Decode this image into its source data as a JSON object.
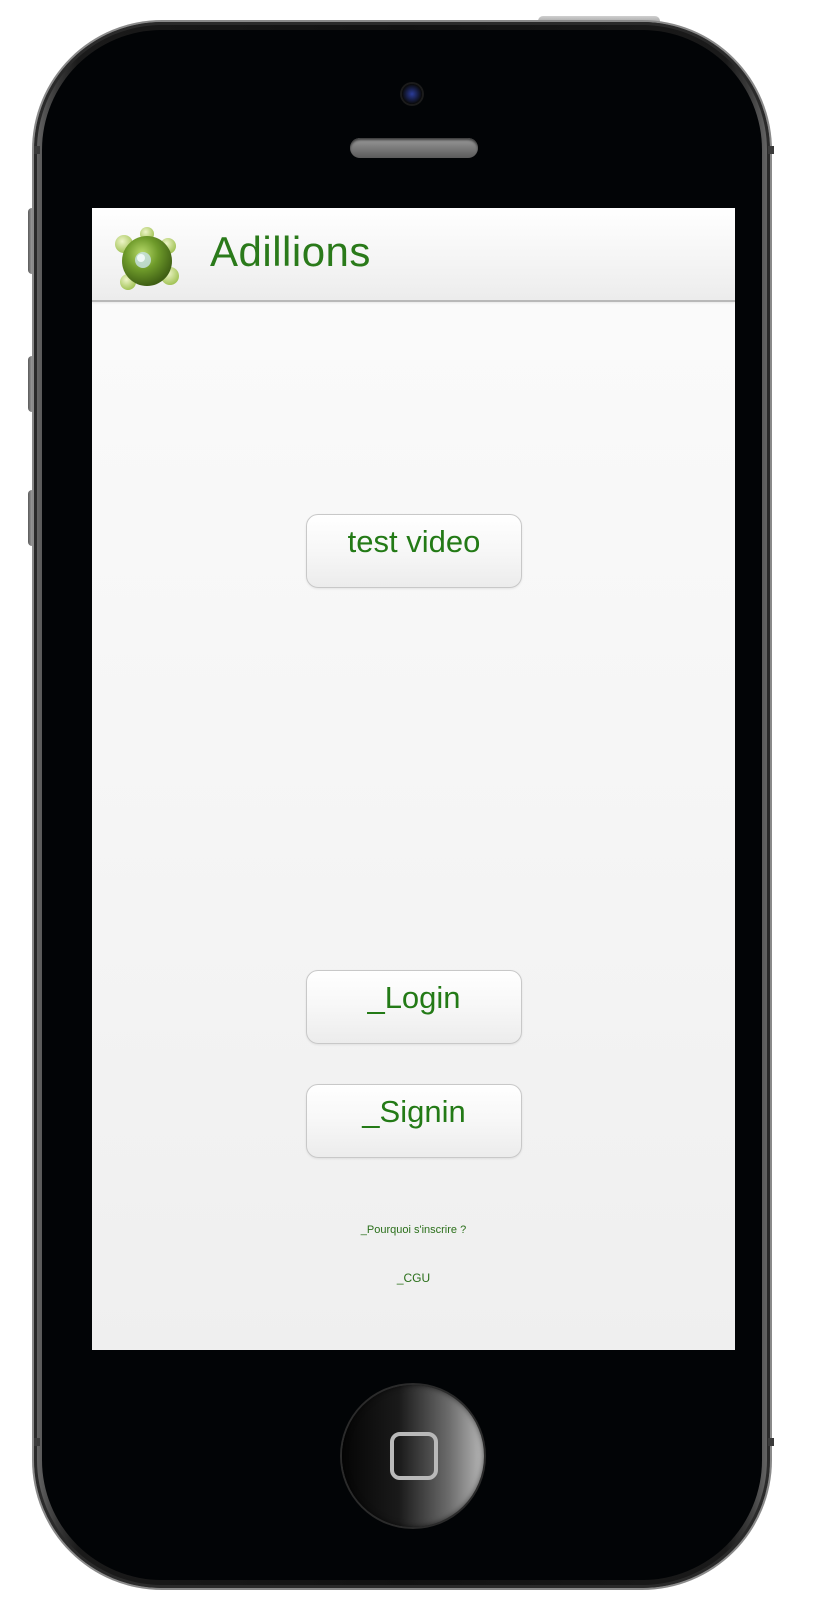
{
  "app": {
    "title": "Adillions"
  },
  "buttons": {
    "test_video": "test video",
    "login": "_Login",
    "signin": "_Signin"
  },
  "links": {
    "why_register": "_Pourquoi s'inscrire ?",
    "cgu": "_CGU"
  },
  "icons": {
    "logo": "green-molecule-icon",
    "home": "home-button-icon"
  },
  "colors": {
    "accent_green": "#2a7a1a",
    "screen_background": "#f5f5f5",
    "phone_body": "#020406"
  }
}
